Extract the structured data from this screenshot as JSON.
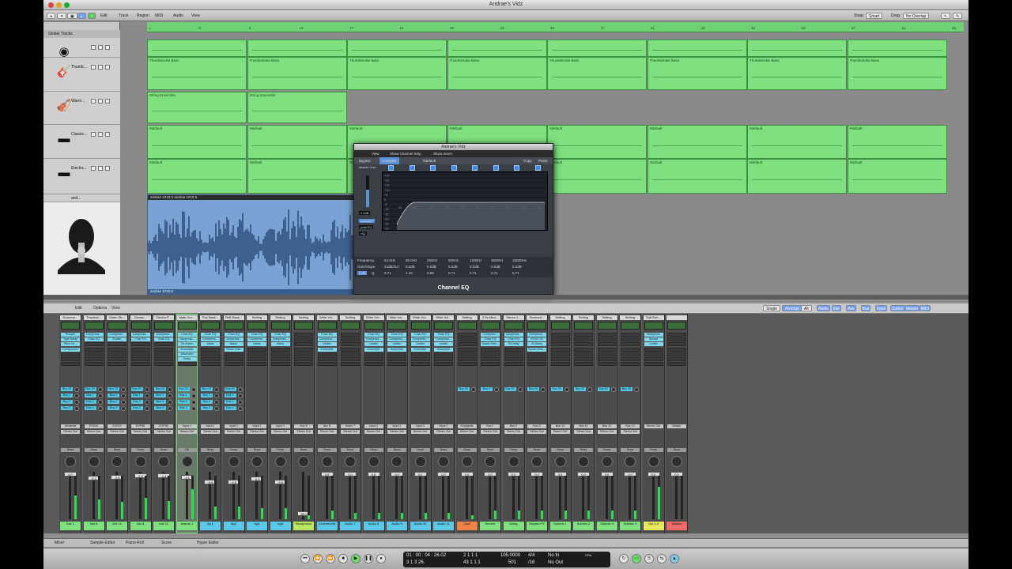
{
  "window": {
    "title": "Andrae's Vidz"
  },
  "toolbar": {
    "menus": [
      "Edit",
      "Track",
      "Region",
      "MIDI",
      "Audio",
      "View"
    ],
    "snap_label": "Snap:",
    "snap_value": "Smart",
    "drag_label": "Drag:",
    "drag_value": "No Overlap"
  },
  "global_tracks": "Global Tracks",
  "ruler": {
    "bars": [
      "1",
      "5",
      "9",
      "13",
      "17",
      "21",
      "25",
      "29",
      "33",
      "37",
      "41",
      "45",
      "49",
      "53",
      "57",
      "61",
      "65",
      "69"
    ]
  },
  "tracks": [
    {
      "name": "",
      "icon": "drum-icon",
      "glyph": "◉"
    },
    {
      "name": "Thumb...",
      "icon": "guitar-icon",
      "glyph": "🎸"
    },
    {
      "name": "Warm...",
      "icon": "violin-icon",
      "glyph": "🎻"
    },
    {
      "name": "Classic...",
      "icon": "keyboard-icon",
      "glyph": "▬"
    },
    {
      "name": "Electra...",
      "icon": "keyboard-icon",
      "glyph": "▬"
    },
    {
      "name": "and...",
      "icon": "avatar-icon",
      "glyph": "👤"
    }
  ],
  "regions": {
    "row1": [
      "",
      "",
      "",
      "",
      "",
      "",
      "",
      ""
    ],
    "row2": [
      "Thumbstroke Bass",
      "Thumbstroke Bass",
      "Thumbstroke Bass",
      "Thumbstroke Bass",
      "Thumbstroke Bass",
      "Thumbstroke Bass",
      "Thumbstroke Bass",
      "Thumbstroke Bass"
    ],
    "row3": [
      "String Ensemble",
      "String Ensemble"
    ],
    "row4": [
      "#default",
      "#default",
      "#default",
      "#default",
      "#default",
      "#default",
      "#default",
      "#default"
    ],
    "row5": [
      "#default",
      "#default",
      "#default",
      "#default",
      "#default",
      "#default",
      "#default",
      "#default"
    ]
  },
  "audio_region": {
    "header": "andrae 1#19.5 andrae 1#19.6",
    "footer": "andrae 1#19.6"
  },
  "channel_eq": {
    "window_title": "Andrae's Vidz",
    "view": "View",
    "show_strip": "Show Channel Strip",
    "show_insert": "Show Insert",
    "bypass": "Bypass",
    "compare": "Compare",
    "preset": "#default",
    "copy": "Copy",
    "paste": "Paste",
    "master_gain": "Master Gain",
    "gain_value": "0.0dB",
    "analyzer": "Analyzer",
    "post_eq": "post EQ",
    "hq": "HQ",
    "db_scale": [
      "+24",
      "+20",
      "+15",
      "+10",
      "+5",
      "0",
      "-5",
      "-10",
      "-15",
      "-20",
      "-25",
      "-30"
    ],
    "freq_scale": [
      "20",
      "50",
      "100",
      "200",
      "500",
      "1k",
      "2k",
      "5k",
      "10k",
      "20k"
    ],
    "freq_row_label": "Frequency",
    "gain_row_label": "Gain/Slope",
    "q_row_label": "Q",
    "link": "Link",
    "freqs": [
      "64.0Hz",
      "80.0Hz",
      "250Hz",
      "500Hz",
      "1200Hz",
      "3500Hz",
      "10000Hz"
    ],
    "gains": [
      "24dB/Oct",
      "0.0dB",
      "0.0dB",
      "0.0dB",
      "0.0dB",
      "0.0dB",
      "0.0dB"
    ],
    "qs": [
      "0.71",
      "1.10",
      "0.98",
      "0.71",
      "0.71",
      "0.71",
      "0.71"
    ],
    "name": "Channel EQ"
  },
  "mixer_toolbar": {
    "menus": [
      "Edit",
      "Options",
      "View"
    ],
    "modes": [
      "Single",
      "Arrange",
      "All"
    ],
    "filters": [
      "Audio",
      "Inst",
      "Aux",
      "Bus",
      "Input",
      "Output",
      "Master",
      "MIDI"
    ]
  },
  "mixer": {
    "strips": [
      {
        "name": "Drumme...",
        "ins": [
          "Pumper",
          "Tape Delay",
          "Pitch Ch...",
          "Compressor"
        ],
        "sends": [
          "Bus 20",
          "Bus 1",
          "Bus 2",
          "Bus 3"
        ],
        "io": [
          "Ultrabeat",
          "Stereo Out"
        ],
        "read": "Read",
        "val": "0.0",
        "label": "Inst 1",
        "color": "#7ee07f",
        "meter": 0.55
      },
      {
        "name": "Thumbst...",
        "ins": [
          "Compress...",
          "Chan EQ"
        ],
        "sends": [
          "Bus 20",
          "Bus 1",
          "Bus 2",
          "Bus 3"
        ],
        "io": [
          "EXS24",
          "Stereo Out"
        ],
        "read": "Read",
        "val": "-5.2",
        "label": "Inst 6",
        "color": "#7ee07f",
        "meter": 0.45
      },
      {
        "name": "Warm Str...",
        "ins": [
          "Compress...",
          "Exciter"
        ],
        "sends": [
          "Bus 20",
          "Bus 1",
          "Bus 2",
          "Bus 3"
        ],
        "io": [
          "EXS24",
          "Stereo Out"
        ],
        "read": "Read",
        "val": "-3.8",
        "label": "Inst 10",
        "color": "#7ee07f",
        "meter": 0.4
      },
      {
        "name": "Classic...",
        "ins": [
          "Compress...",
          "Chan EQ"
        ],
        "sends": [
          "Bus 20",
          "Bus 1",
          "Bus 2",
          "Bus 3"
        ],
        "io": [
          "EVP88",
          "Stereo Out"
        ],
        "read": "Read",
        "val": "-2.2",
        "label": "Inst 8",
        "color": "#7ee07f",
        "meter": 0.5
      },
      {
        "name": "Electra P...",
        "ins": [
          "Compress...",
          "Chan EQ"
        ],
        "sends": [
          "Bus 20",
          "Bus 1",
          "Bus 2",
          "Bus 3"
        ],
        "io": [
          "EVP88",
          "Stereo Out"
        ],
        "read": "Read",
        "val": "-1.6",
        "label": "Inst 11",
        "color": "#7ee07f",
        "meter": 0.42
      },
      {
        "name": "Male Cre...",
        "ins": [
          "Chan EQ",
          "Compress...",
          "De-Esser",
          "Ensemble",
          "Silververb",
          "Delay"
        ],
        "sends": [
          "Bus 20",
          "Bus 1",
          "Bus 2",
          "Bus 3"
        ],
        "io": [
          "Input 1",
          "Stereo Out"
        ],
        "read": "Off",
        "val": "-4.1",
        "label": "andrae 1",
        "color": "#7ee07f",
        "meter": 0.7
      },
      {
        "name": "Pop Back...",
        "ins": [
          "Chan EQ",
          "Compress...",
          "Ataris"
        ],
        "sends": [
          "Bus 20",
          "Bus 1",
          "Bus 2",
          "Bus 3"
        ],
        "io": [
          "Input 1",
          "Stereo Out"
        ],
        "read": "Read",
        "val": "-9.8",
        "label": "bg 1",
        "color": "#5ac8e6",
        "meter": 0.3
      },
      {
        "name": "RnB Back...",
        "ins": [
          "Chan EQ",
          "Compress...",
          "Ataris",
          "Noise Gate"
        ],
        "sends": [
          "Bus 20",
          "Bus 1",
          "Bus 2",
          "Bus 3"
        ],
        "io": [
          "Input 1",
          "Stereo Out"
        ],
        "read": "Read",
        "val": "-9.8",
        "label": "bg2",
        "color": "#5ac8e6",
        "meter": 0.3
      },
      {
        "name": "Setting",
        "ins": [
          "Chan EQ",
          "Compress...",
          "Ataris"
        ],
        "sends": [],
        "io": [
          "Input 1",
          "Stereo Out"
        ],
        "read": "Read",
        "val": "-6.3",
        "label": "bg3",
        "color": "#5ac8e6",
        "meter": 0.25
      },
      {
        "name": "Setting",
        "ins": [
          "Chan EQ",
          "Compress...",
          "Ataris"
        ],
        "sends": [],
        "io": [
          "Input 1",
          "Stereo Out"
        ],
        "read": "Read",
        "val": "-9.8",
        "label": "bgtt",
        "color": "#5ac8e6",
        "meter": 0.25
      },
      {
        "name": "Setting",
        "ins": [],
        "sends": [],
        "io": [
          "Aux 8",
          "Stereo Out"
        ],
        "read": "Read",
        "val": "-50.0",
        "label": "Headphone",
        "color": "#b9e85e",
        "meter": 0.1
      },
      {
        "name": "Wide Vol...",
        "ins": [
          "Chan EQ",
          "Compress...",
          "Limiter",
          "Ensemble"
        ],
        "sends": [],
        "io": [
          "Aux 8",
          "Stereo Out"
        ],
        "read": "Read",
        "val": "0.0",
        "label": "Loverreverb",
        "color": "#5ac8e6",
        "meter": 0.2
      },
      {
        "name": "Setting",
        "ins": [],
        "sends": [],
        "io": [
          "Audio 7",
          "Stereo Out"
        ],
        "read": "Read",
        "val": "0.0",
        "label": "Audio 7",
        "color": "#5ac8e6",
        "meter": 0.15
      },
      {
        "name": "Wide Vol...",
        "ins": [
          "Chan EQ",
          "Compress...",
          "Limiter",
          "Ensemble"
        ],
        "sends": [],
        "io": [
          "Input 1",
          "Stereo Out"
        ],
        "read": "Read",
        "val": "0.0",
        "label": "Audio 8",
        "color": "#5ac8e6",
        "meter": 0.15
      },
      {
        "name": "Wide Vol...",
        "ins": [
          "Chan EQ",
          "Compress...",
          "Limiter",
          "Ensemble"
        ],
        "sends": [],
        "io": [
          "Input 1",
          "Stereo Out"
        ],
        "read": "Read",
        "val": "0.0",
        "label": "Audio 9",
        "color": "#5ac8e6",
        "meter": 0.15
      },
      {
        "name": "Wide Vol...",
        "ins": [
          "Chan EQ",
          "Compress...",
          "Limiter",
          "Ensemble"
        ],
        "sends": [],
        "io": [
          "Input 1",
          "Stereo Out"
        ],
        "read": "Read",
        "val": "0.0",
        "label": "Audio 10",
        "color": "#5ac8e6",
        "meter": 0.15
      },
      {
        "name": "Wide Vol...",
        "ins": [
          "Chan EQ",
          "Compress...",
          "Limiter",
          "Ensemble"
        ],
        "sends": [],
        "io": [
          "Input 1",
          "Stereo Out"
        ],
        "read": "Read",
        "val": "0.0",
        "label": "Audio 11",
        "color": "#5ac8e6",
        "meter": 0.15
      },
      {
        "name": "Setting",
        "ins": [],
        "sends": [
          "Bus 20"
        ],
        "io": [
          "Klopfgeist",
          "Stereo Out"
        ],
        "read": "Read",
        "val": "0.0",
        "label": "Click",
        "color": "#f0834a",
        "meter": 0.1
      },
      {
        "name": "2.0s Med...",
        "ins": [
          "Compress...",
          "Chan EQ",
          "Space Desi..."
        ],
        "sends": [
          "Bus 2"
        ],
        "io": [
          "Bus 1",
          "Stereo Out"
        ],
        "read": "Read",
        "val": "0.0",
        "label": "Reverb",
        "color": "#7ee07f",
        "meter": 0.2
      },
      {
        "name": "Stereo 1...",
        "ins": [
          "Compress...",
          "Chan EQ",
          "St-Delay"
        ],
        "sends": [
          "Bus 20"
        ],
        "io": [
          "Bus 2",
          "Stereo Out"
        ],
        "read": "Read",
        "val": "0.0",
        "label": "Delay",
        "color": "#7ee07f",
        "meter": 0.2
      },
      {
        "name": "Permont...",
        "ins": [
          "Compress...",
          "EVOC 20",
          "St-Delay",
          "Space Desi..."
        ],
        "sends": [
          "Bus 20"
        ],
        "io": [
          "Bus 3",
          "Stereo Out"
        ],
        "read": "Read",
        "val": "0.0",
        "label": "Harped FX",
        "color": "#7ee07f",
        "meter": 0.2
      },
      {
        "name": "Setting",
        "ins": [],
        "sends": [
          "Bus 20"
        ],
        "io": [
          "Bus 10",
          "Stereo Out"
        ],
        "read": "Read",
        "val": "0.0",
        "label": "Submix 1",
        "color": "#7ee07f",
        "meter": 0.2
      },
      {
        "name": "Setting",
        "ins": [],
        "sends": [
          "Bus 20"
        ],
        "io": [
          "Bus 11",
          "Stereo Out"
        ],
        "read": "Read",
        "val": "0.0",
        "label": "Submix 2",
        "color": "#7ee07f",
        "meter": 0.2
      },
      {
        "name": "Setting",
        "ins": [],
        "sends": [
          "Bus 20"
        ],
        "io": [
          "Bus 12",
          "Stereo Out"
        ],
        "read": "Read",
        "val": "0.0",
        "label": "Submix 3",
        "color": "#7ee07f",
        "meter": 0.2
      },
      {
        "name": "Setting",
        "ins": [],
        "sends": [
          "Bus 20"
        ],
        "io": [
          "Bus 13",
          "Stereo Out"
        ],
        "read": "Read",
        "val": "0.0",
        "label": "Submix 4",
        "color": "#7ee07f",
        "meter": 0.2
      },
      {
        "name": "Soft Enh...",
        "ins": [
          "Multipress",
          "Spread",
          "Limiter"
        ],
        "sends": [],
        "io": [
          "Stereo Out",
          ""
        ],
        "read": "Read",
        "val": "0.0",
        "label": "Out 1-2",
        "color": "#e8e85e",
        "meter": 0.75
      },
      {
        "name": "",
        "ins": [],
        "sends": [],
        "io": [
          "Master",
          ""
        ],
        "read": "Read",
        "val": "0.0",
        "label": "Master",
        "color": "#f06a6a",
        "meter": 0.0
      }
    ]
  },
  "bottom_tabs": [
    "Mixer",
    "Sample Editor",
    "Piano Roll",
    "Score",
    "Hyper Editor"
  ],
  "transport": {
    "smpte": "01 : 00 : 04 : 26.02",
    "bars": "3  1  3  26.",
    "pos1": "2  1  1  1",
    "pos2": "43  1  1  1",
    "tempo": "105.0000",
    "division": "501",
    "sig": "4/4",
    "div": "/16",
    "in": "No In",
    "out": "No Out",
    "cpu": "CPU"
  }
}
